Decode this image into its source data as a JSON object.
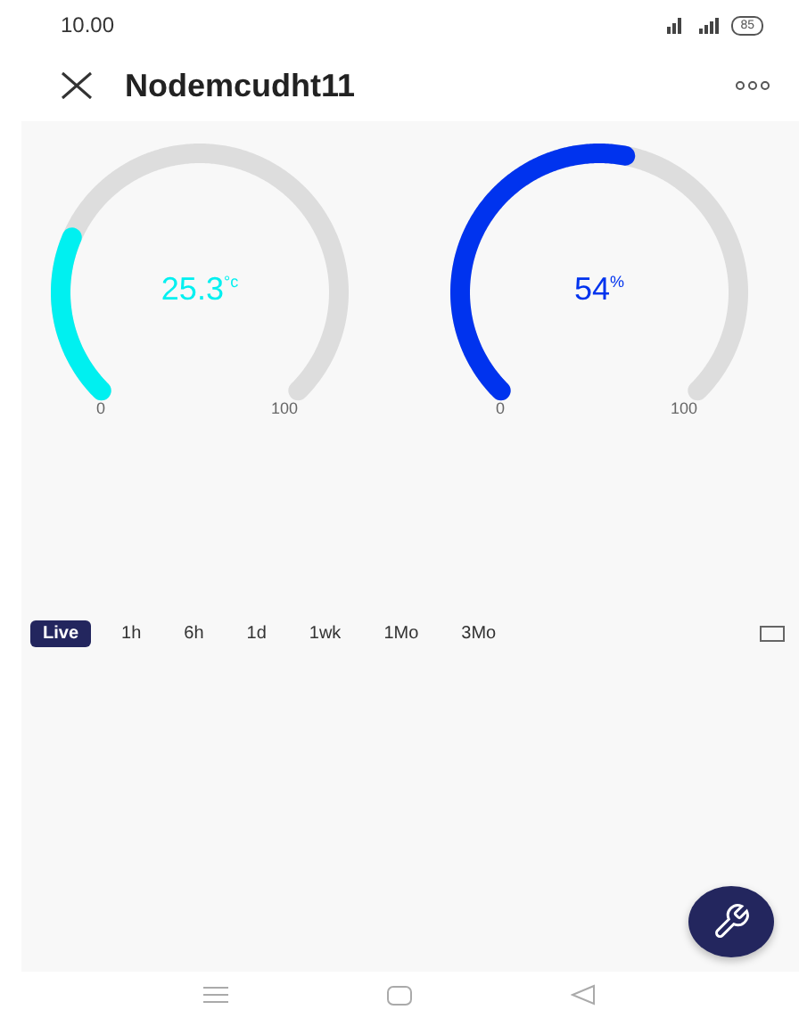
{
  "status_bar": {
    "time": "10.00",
    "battery": "85"
  },
  "header": {
    "title": "Nodemcudht11"
  },
  "gauges": [
    {
      "value": "25.3",
      "unit": "°c",
      "level": 0.253,
      "color": "#00f0f0",
      "min": "0",
      "max": "100"
    },
    {
      "value": "54",
      "unit": "%",
      "level": 0.54,
      "color": "#0033ee",
      "min": "0",
      "max": "100"
    }
  ],
  "time_ranges": [
    {
      "label": "Live",
      "selected": true
    },
    {
      "label": "1h",
      "selected": false
    },
    {
      "label": "6h",
      "selected": false
    },
    {
      "label": "1d",
      "selected": false
    },
    {
      "label": "1wk",
      "selected": false
    },
    {
      "label": "1Mo",
      "selected": false
    },
    {
      "label": "3Mo",
      "selected": false
    }
  ]
}
